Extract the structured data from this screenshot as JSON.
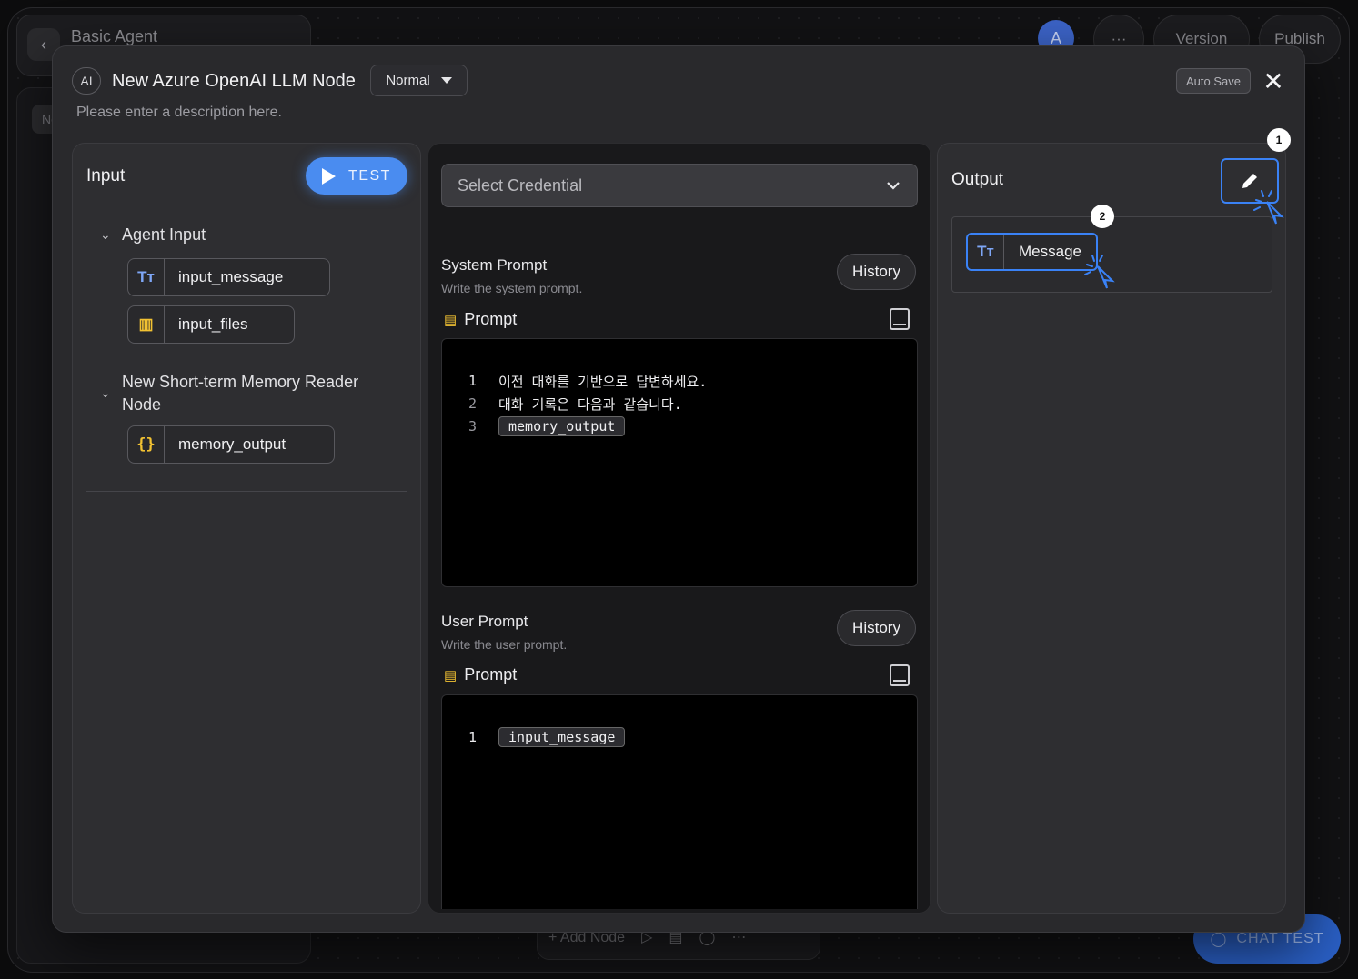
{
  "background": {
    "app_title": "Basic Agent",
    "avatar_initial": "A",
    "more_label": "···",
    "version_label": "Version",
    "publish_label": "Publish",
    "add_node_label": "+ Add Node",
    "chat_test_label": "CHAT TEST",
    "side_tab_partial": "Ne"
  },
  "modal": {
    "ai_badge": "AI",
    "title": "New Azure OpenAI LLM Node",
    "mode": "Normal",
    "description_placeholder": "Please enter a description here.",
    "autosave_label": "Auto Save",
    "close_glyph": "✕"
  },
  "input_panel": {
    "heading": "Input",
    "test_label": "TEST",
    "groups": [
      {
        "name": "Agent Input",
        "vars": [
          {
            "icon": "Tт",
            "name": "input_message"
          },
          {
            "icon": "▥",
            "name": "input_files"
          }
        ]
      },
      {
        "name_line1": "New Short-term Memory Reader",
        "name_line2": "Node",
        "vars": [
          {
            "icon": "{}",
            "name": "memory_output"
          }
        ]
      }
    ]
  },
  "prompt_panel": {
    "credential_placeholder": "Select Credential",
    "system": {
      "title": "System Prompt",
      "subtitle": "Write the system prompt.",
      "history_label": "History",
      "prompt_label": "Prompt",
      "lines": [
        {
          "num": "1",
          "text": "이전 대화를 기반으로 답변하세요."
        },
        {
          "num": "2",
          "text": "대화 기록은 다음과 같습니다."
        },
        {
          "num": "3",
          "token": "memory_output"
        }
      ]
    },
    "user": {
      "title": "User Prompt",
      "subtitle": "Write the user prompt.",
      "history_label": "History",
      "prompt_label": "Prompt",
      "lines": [
        {
          "num": "1",
          "token": "input_message"
        }
      ]
    }
  },
  "output_panel": {
    "heading": "Output",
    "step1": "1",
    "step2": "2",
    "outputs": [
      {
        "icon": "Tт",
        "name": "Message"
      }
    ]
  },
  "colors": {
    "accent": "#3a82f6",
    "test_button": "#4a8cf0",
    "variable_icon_yellow": "#f2c232",
    "text_icon_blue": "#7ea6f6"
  }
}
